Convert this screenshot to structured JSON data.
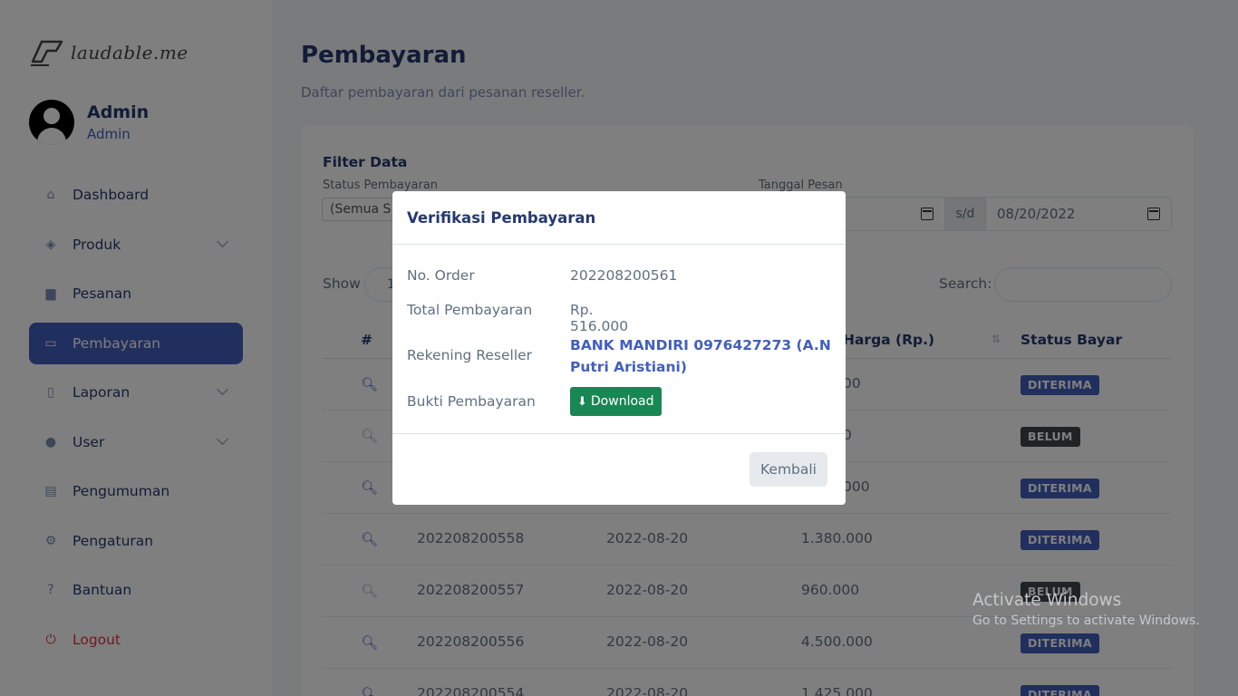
{
  "brand": {
    "name": "laudable.me"
  },
  "profile": {
    "name": "Admin",
    "role": "Admin"
  },
  "menu": [
    {
      "label": "Dashboard",
      "icon": "home-icon",
      "glyph": "⌂"
    },
    {
      "label": "Produk",
      "icon": "tag-icon",
      "glyph": "◈"
    },
    {
      "label": "Pesanan",
      "icon": "cart-icon",
      "glyph": "▆"
    },
    {
      "label": "Pembayaran",
      "icon": "cash-icon",
      "glyph": "▭"
    },
    {
      "label": "Laporan",
      "icon": "file-icon",
      "glyph": "▯"
    },
    {
      "label": "User",
      "icon": "users-icon",
      "glyph": "●"
    },
    {
      "label": "Pengumuman",
      "icon": "newspaper-icon",
      "glyph": "▤"
    },
    {
      "label": "Pengaturan",
      "icon": "gear-icon",
      "glyph": "⚙"
    },
    {
      "label": "Bantuan",
      "icon": "question-icon",
      "glyph": "?"
    },
    {
      "label": "Logout",
      "icon": "power-icon",
      "glyph": "⏻"
    }
  ],
  "page": {
    "title": "Pembayaran",
    "subtitle": "Daftar pembayaran dari pesanan reseller."
  },
  "filter": {
    "title": "Filter Data",
    "status_label": "Status Pembayaran",
    "status_value": "(Semua S",
    "date_label": "Tanggal Pesan",
    "date_from": "",
    "date_sep": "s/d",
    "date_to": "08/20/2022"
  },
  "table": {
    "show_label": "Show",
    "show_value": "1",
    "search_label": "Search:",
    "headers": {
      "no": "#",
      "harga": "Harga (Rp.)",
      "status": "Status Bayar"
    },
    "rows": [
      {
        "order": "",
        "date": "",
        "total": "00",
        "status": "DITERIMA",
        "verified": true
      },
      {
        "order": "",
        "date": "",
        "total": "0",
        "status": "BELUM",
        "verified": false
      },
      {
        "order": "",
        "date": "",
        "total": "000",
        "status": "DITERIMA",
        "verified": true
      },
      {
        "order": "202208200558",
        "date": "2022-08-20",
        "total": "1.380.000",
        "status": "DITERIMA",
        "verified": true
      },
      {
        "order": "202208200557",
        "date": "2022-08-20",
        "total": "960.000",
        "status": "BELUM",
        "verified": false
      },
      {
        "order": "202208200556",
        "date": "2022-08-20",
        "total": "4.500.000",
        "status": "DITERIMA",
        "verified": true
      },
      {
        "order": "202208200554",
        "date": "2022-08-20",
        "total": "1.425.000",
        "status": "DITERIMA",
        "verified": true
      }
    ]
  },
  "modal": {
    "title": "Verifikasi Pembayaran",
    "order_label": "No. Order",
    "order_value": "202208200561",
    "total_label": "Total Pembayaran",
    "total_value": "Rp. 516.000",
    "account_label": "Rekening Reseller",
    "account_value": "BANK MANDIRI 0976427273 (A.N Putri Aristiani)",
    "proof_label": "Bukti Pembayaran",
    "download_label": "Download",
    "back_label": "Kembali"
  },
  "watermark": {
    "line1": "Activate Windows",
    "line2": "Go to Settings to activate Windows."
  }
}
